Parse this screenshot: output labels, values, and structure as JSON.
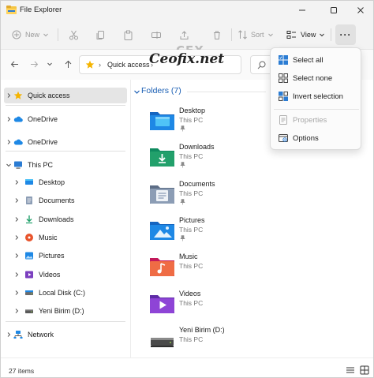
{
  "window": {
    "title": "File Explorer"
  },
  "toolbar": {
    "new_label": "New",
    "sort_label": "Sort",
    "view_label": "View",
    "more_label": "···"
  },
  "address": {
    "path": "Quick access"
  },
  "watermark": {
    "text": "Ceofix.net",
    "logo": "CFX"
  },
  "sidebar": {
    "items": [
      {
        "label": "Quick access",
        "icon": "star-icon",
        "expandable": true,
        "selected": true
      },
      {
        "label": "OneDrive",
        "icon": "cloud-icon",
        "expandable": true
      },
      {
        "label": "OneDrive",
        "icon": "cloud-icon",
        "expandable": true
      },
      {
        "label": "This PC",
        "icon": "pc-icon",
        "expandable": true,
        "expanded": true
      },
      {
        "label": "Desktop",
        "icon": "desktop-icon",
        "expandable": true
      },
      {
        "label": "Documents",
        "icon": "documents-icon",
        "expandable": true
      },
      {
        "label": "Downloads",
        "icon": "downloads-icon",
        "expandable": true
      },
      {
        "label": "Music",
        "icon": "music-icon",
        "expandable": true
      },
      {
        "label": "Pictures",
        "icon": "pictures-icon",
        "expandable": true
      },
      {
        "label": "Videos",
        "icon": "videos-icon",
        "expandable": true
      },
      {
        "label": "Local Disk (C:)",
        "icon": "local-disk-icon",
        "expandable": true
      },
      {
        "label": "Yeni Birim (D:)",
        "icon": "drive-icon",
        "expandable": true
      },
      {
        "label": "Network",
        "icon": "network-icon",
        "expandable": true
      }
    ]
  },
  "main": {
    "group_label": "Folders (7)",
    "tiles": [
      {
        "name": "Desktop",
        "sub": "This PC",
        "icon": "desktop-folder-icon",
        "pinned": true
      },
      {
        "name": "Downloads",
        "sub": "This PC",
        "icon": "downloads-folder-icon",
        "pinned": true
      },
      {
        "name": "Documents",
        "sub": "This PC",
        "icon": "documents-folder-icon",
        "pinned": true
      },
      {
        "name": "Pictures",
        "sub": "This PC",
        "icon": "pictures-folder-icon",
        "pinned": true
      },
      {
        "name": "Music",
        "sub": "This PC",
        "icon": "music-folder-icon",
        "pinned": false
      },
      {
        "name": "Videos",
        "sub": "This PC",
        "icon": "videos-folder-icon",
        "pinned": false
      },
      {
        "name": "Yeni Birim (D:)",
        "sub": "This PC",
        "icon": "drive-icon",
        "pinned": false
      }
    ]
  },
  "menu": {
    "items": [
      {
        "label": "Select all",
        "icon": "select-all-icon",
        "enabled": true
      },
      {
        "label": "Select none",
        "icon": "select-none-icon",
        "enabled": true
      },
      {
        "label": "Invert selection",
        "icon": "invert-selection-icon",
        "enabled": true
      },
      {
        "label": "Properties",
        "icon": "properties-icon",
        "enabled": false
      },
      {
        "label": "Options",
        "icon": "options-icon",
        "enabled": true
      }
    ]
  },
  "status": {
    "item_count": "27 items"
  },
  "colors": {
    "accent": "#0067c0",
    "folder_blue": "#1e88e5",
    "chrome_bg": "#f3f3f3",
    "selected_bg": "#e5e5e5"
  }
}
